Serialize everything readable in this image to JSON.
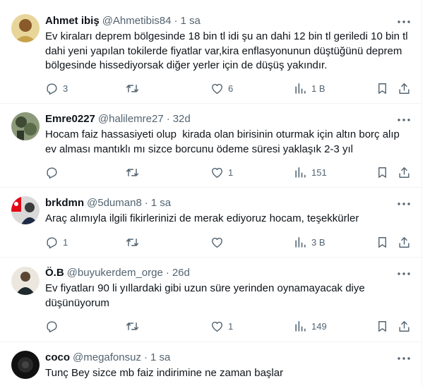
{
  "tweets": [
    {
      "name": "Ahmet ibiş",
      "handle": "@Ahmetibis84",
      "time": "1 sa",
      "text": "Ev kiraları deprem bölgesinde 18 bin tl idi şu an dahi 12 bin tl geriledi 10 bin tl dahi yeni yapılan tokilerde fiyatlar var,kira enflasyonunun düştüğünü deprem bölgesinde hissediyorsak diğer yerler için de düşüş yakındır.",
      "replies": "3",
      "retweets": "",
      "likes": "6",
      "views": "1 B",
      "avatar_color": "#c8a24a"
    },
    {
      "name": "Emre0227",
      "handle": "@halilemre27",
      "time": "32d",
      "text": "Hocam faiz hassasiyeti olup  kirada olan birisinin oturmak için altın borç alıp ev alması mantıklı mı sizce borcunu ödeme süresi yaklaşık 2-3 yıl",
      "replies": "",
      "retweets": "",
      "likes": "1",
      "views": "151",
      "avatar_color": "#5a6b4a"
    },
    {
      "name": "brkdmn",
      "handle": "@5duman8",
      "time": "1 sa",
      "text": "Araç alımıyla ilgili fikirlerinizi de merak ediyoruz hocam, teşekkürler",
      "replies": "1",
      "retweets": "",
      "likes": "",
      "views": "3 B",
      "avatar_color": "#d9d9d9"
    },
    {
      "name": "Ö.B",
      "handle": "@buyukerdem_orge",
      "time": "26d",
      "text": "Ev fiyatları 90 li yıllardaki gibi uzun süre yerinden oynamayacak diye düşünüyorum",
      "replies": "",
      "retweets": "",
      "likes": "1",
      "views": "149",
      "avatar_color": "#e8e2d8"
    },
    {
      "name": "coco",
      "handle": "@megafonsuz",
      "time": "1 sa",
      "text": "Tunç Bey sizce mb faiz indirimine ne zaman başlar",
      "replies": "",
      "retweets": "",
      "likes": "",
      "views": "",
      "avatar_color": "#1a1a1a"
    }
  ],
  "colors": {
    "text": "#0f1419",
    "secondary": "#536471",
    "border": "#eff3f4"
  },
  "icons": [
    "more-icon",
    "reply-icon",
    "retweet-icon",
    "like-icon",
    "views-icon",
    "bookmark-icon",
    "share-icon"
  ]
}
